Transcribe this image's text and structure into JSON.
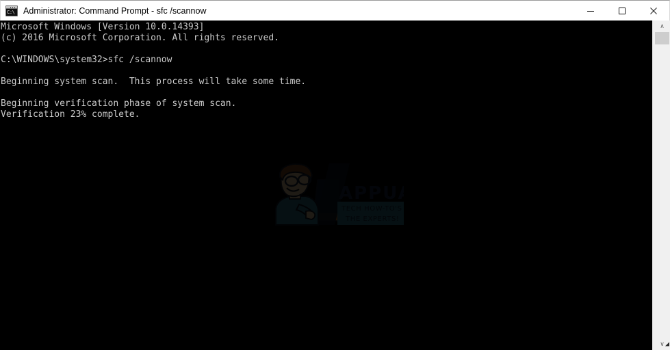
{
  "window": {
    "title": "Administrator: Command Prompt - sfc  /scannow",
    "icon": "command-prompt-icon",
    "icon_text": "C:\\",
    "background_color": "#000000",
    "titlebar_color": "#ffffff",
    "text_color": "#cccccc"
  },
  "controls": {
    "minimize_label": "Minimize",
    "maximize_label": "Maximize",
    "close_label": "Close"
  },
  "console": {
    "lines": [
      "Microsoft Windows [Version 10.0.14393]",
      "(c) 2016 Microsoft Corporation. All rights reserved.",
      "",
      "C:\\WINDOWS\\system32>sfc /scannow",
      "",
      "Beginning system scan.  This process will take some time.",
      "",
      "Beginning verification phase of system scan.",
      "Verification 23% complete."
    ],
    "text": "Microsoft Windows [Version 10.0.14393]\n(c) 2016 Microsoft Corporation. All rights reserved.\n\nC:\\WINDOWS\\system32>sfc /scannow\n\nBeginning system scan.  This process will take some time.\n\nBeginning verification phase of system scan.\nVerification 23% complete.",
    "command": "sfc /scannow",
    "prompt_path": "C:\\WINDOWS\\system32>",
    "os_version": "10.0.14393",
    "copyright_year": "2016",
    "progress_percent": "23%"
  },
  "watermark": {
    "brand": "APPUALS",
    "tagline_line1": "TECH HOW-TO'S FROM",
    "tagline_line2": "THE EXPERTS!",
    "brand_color": "#1b2a4a",
    "tagline_bg_color": "#2c7a8c",
    "tagline_text_color": "#1b2a4a"
  },
  "scrollbar": {
    "up_arrow": "∧",
    "down_arrow": "∨",
    "thumb_position_percent": "3"
  },
  "resize": {
    "grip_glyph": "◢"
  }
}
